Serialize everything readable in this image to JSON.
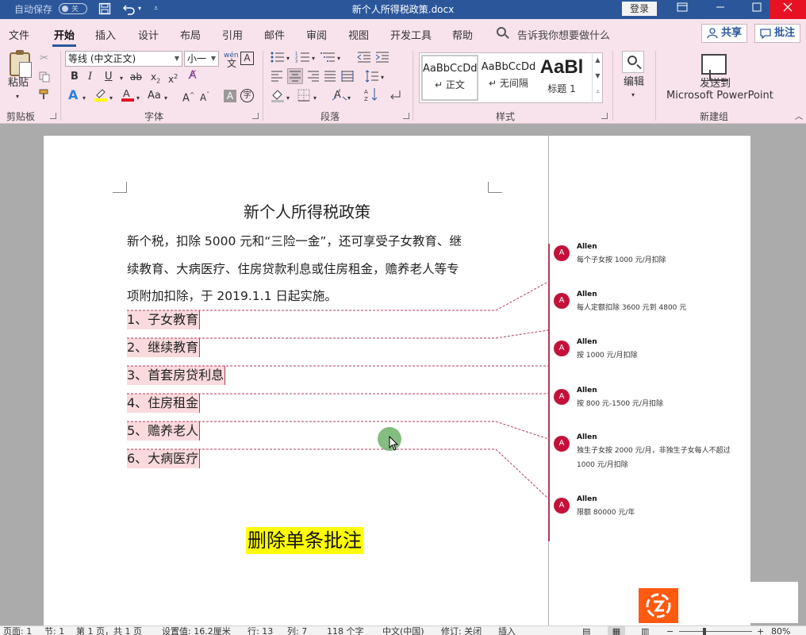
{
  "titlebar": {
    "autosave_label": "自动保存",
    "autosave_state": "关",
    "doc_title": "新个人所得税政策.docx",
    "login": "登录",
    "icons": [
      "save-icon",
      "undo-icon",
      "redo-icon",
      "customize-icon",
      "ribbon-display-icon",
      "minimize-icon",
      "maximize-icon",
      "close-icon"
    ]
  },
  "menu": {
    "tabs": [
      "文件",
      "开始",
      "插入",
      "设计",
      "布局",
      "引用",
      "邮件",
      "审阅",
      "视图",
      "开发工具",
      "帮助"
    ],
    "active_tab": "开始",
    "tell_me": "告诉我你想要做什么",
    "share": "共享",
    "comments": "批注"
  },
  "ribbon": {
    "clipboard": {
      "paste": "粘贴",
      "label": "剪贴板"
    },
    "font": {
      "name": "等线 (中文正文)",
      "size": "小一",
      "wen": "wén",
      "label": "字体"
    },
    "paragraph": {
      "label": "段落"
    },
    "styles": {
      "items": [
        {
          "sample": "AaBbCcDd",
          "name": "正文"
        },
        {
          "sample": "AaBbCcDd",
          "name": "无间隔"
        },
        {
          "sample": "AaBl",
          "name": "标题 1"
        }
      ],
      "label": "样式"
    },
    "editing": {
      "label": "编辑"
    },
    "newgroup": {
      "send": "发送到",
      "ppt": "Microsoft PowerPoint",
      "label": "新建组"
    }
  },
  "document": {
    "title": "新个人所得税政策",
    "para_lines": [
      "新个税，扣除 5000 元和“三险一金”，还可享受子女教育、继",
      "续教育、大病医疗、住房贷款利息或住房租金，赡养老人等专",
      "项附加扣除，于 2019.1.1 日起实施。"
    ],
    "items": [
      "1、子女教育",
      "2、继续教育",
      "3、首套房贷利息",
      "4、住房租金",
      "5、赡养老人",
      "6、大病医疗"
    ],
    "caption": "删除单条批注"
  },
  "comments": [
    {
      "initial": "A",
      "author": "Allen",
      "text": "每个子女按 1000 元/月扣除"
    },
    {
      "initial": "A",
      "author": "Allen",
      "text": "每人定额扣除 3600 元到 4800 元"
    },
    {
      "initial": "A",
      "author": "Allen",
      "text": "按 1000 元/月扣除"
    },
    {
      "initial": "A",
      "author": "Allen",
      "text": "按 800 元-1500 元/月扣除"
    },
    {
      "initial": "A",
      "author": "Allen",
      "text": "独生子女按 2000 元/月，非独生子女每人不超过 1000 元/月扣除"
    },
    {
      "initial": "A",
      "author": "Allen",
      "text": "限额 80000 元/年"
    }
  ],
  "statusbar": {
    "page": "页面: 1",
    "section": "节: 1",
    "pages": "第 1 页，共 1 页",
    "position": "设置值: 16.2厘米",
    "row": "行: 13",
    "col": "列: 7",
    "words": "118 个字",
    "lang": "中文(中国)",
    "track": "修订: 关闭",
    "insert": "插入",
    "zoom": "80%"
  },
  "colors": {
    "title_bar": "#2b579a",
    "ribbon_bg": "#f8e3ec",
    "comment_accent": "#c4113a",
    "highlight": "#ffff00"
  }
}
